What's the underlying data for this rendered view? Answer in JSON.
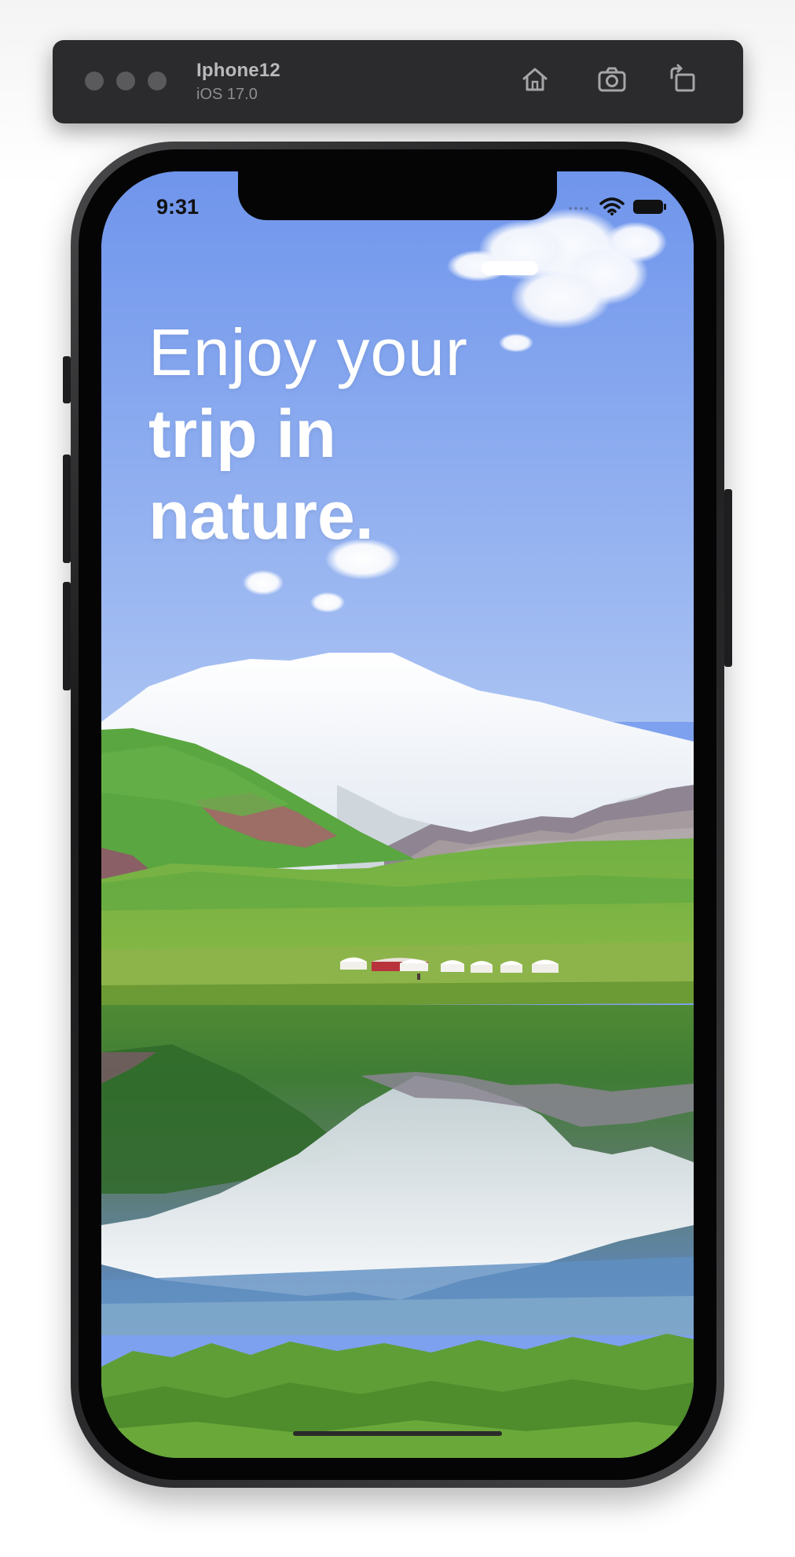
{
  "simulator": {
    "device_name": "Iphone12",
    "os_version": "iOS 17.0",
    "toolbar_icons": [
      "home-icon",
      "screenshot-icon",
      "rotate-icon"
    ]
  },
  "status_bar": {
    "time": "9:31",
    "icons": [
      "wifi-icon",
      "battery-icon"
    ]
  },
  "headline": {
    "line1": "Enjoy your",
    "line2": "trip in",
    "line3": "nature."
  },
  "colors": {
    "sky": "#7da1ee",
    "text": "#ffffff",
    "toolbar": "#2b2b2d"
  }
}
